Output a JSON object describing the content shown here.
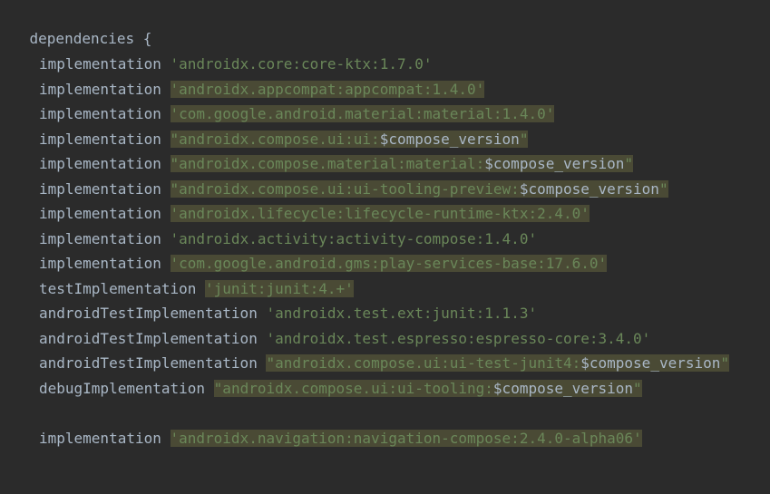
{
  "editor": {
    "header": "dependencies {",
    "lines": [
      {
        "config": "implementation",
        "str": "'androidx.core:core-ktx:1.7.0'",
        "suffix": "",
        "highlighted": false
      },
      {
        "config": "implementation",
        "str": "'androidx.appcompat:appcompat:1.4.0'",
        "suffix": "",
        "highlighted": true
      },
      {
        "config": "implementation",
        "str": "'com.google.android.material:material:1.4.0'",
        "suffix": "",
        "highlighted": true
      },
      {
        "config": "implementation",
        "str": "\"androidx.compose.ui:ui:",
        "var": "$compose_version",
        "suffix": "\"",
        "highlighted": true
      },
      {
        "config": "implementation",
        "str": "\"androidx.compose.material:material:",
        "var": "$compose_version",
        "suffix": "\"",
        "highlighted": true
      },
      {
        "config": "implementation",
        "str": "\"androidx.compose.ui:ui-tooling-preview:",
        "var": "$compose_version",
        "suffix": "\"",
        "highlighted": true
      },
      {
        "config": "implementation",
        "str": "'androidx.lifecycle:lifecycle-runtime-ktx:2.4.0'",
        "suffix": "",
        "highlighted": true
      },
      {
        "config": "implementation",
        "str": "'androidx.activity:activity-compose:1.4.0'",
        "suffix": "",
        "highlighted": false
      },
      {
        "config": "implementation",
        "str": "'com.google.android.gms:play-services-base:17.6.0'",
        "suffix": "",
        "highlighted": true
      },
      {
        "config": "testImplementation",
        "str": "'junit:junit:4.+'",
        "suffix": "",
        "highlighted": true
      },
      {
        "config": "androidTestImplementation",
        "str": "'androidx.test.ext:junit:1.1.3'",
        "suffix": "",
        "highlighted": false
      },
      {
        "config": "androidTestImplementation",
        "str": "'androidx.test.espresso:espresso-core:3.4.0'",
        "suffix": "",
        "highlighted": false
      },
      {
        "config": "androidTestImplementation",
        "str": "\"androidx.compose.ui:ui-test-junit4:",
        "var": "$compose_version",
        "suffix": "\"",
        "highlighted": true
      },
      {
        "config": "debugImplementation",
        "str": "\"androidx.compose.ui:ui-tooling:",
        "var": "$compose_version",
        "suffix": "\"",
        "highlighted": true
      },
      {
        "config": "implementation",
        "str": "'androidx.navigation:navigation-compose:2.4.0-alpha06'",
        "suffix": "",
        "highlighted": true
      }
    ]
  },
  "colors": {
    "background": "#2b2b2b",
    "keyword": "#a9b7c6",
    "string": "#6a8759",
    "highlight": "#4a4a35"
  }
}
